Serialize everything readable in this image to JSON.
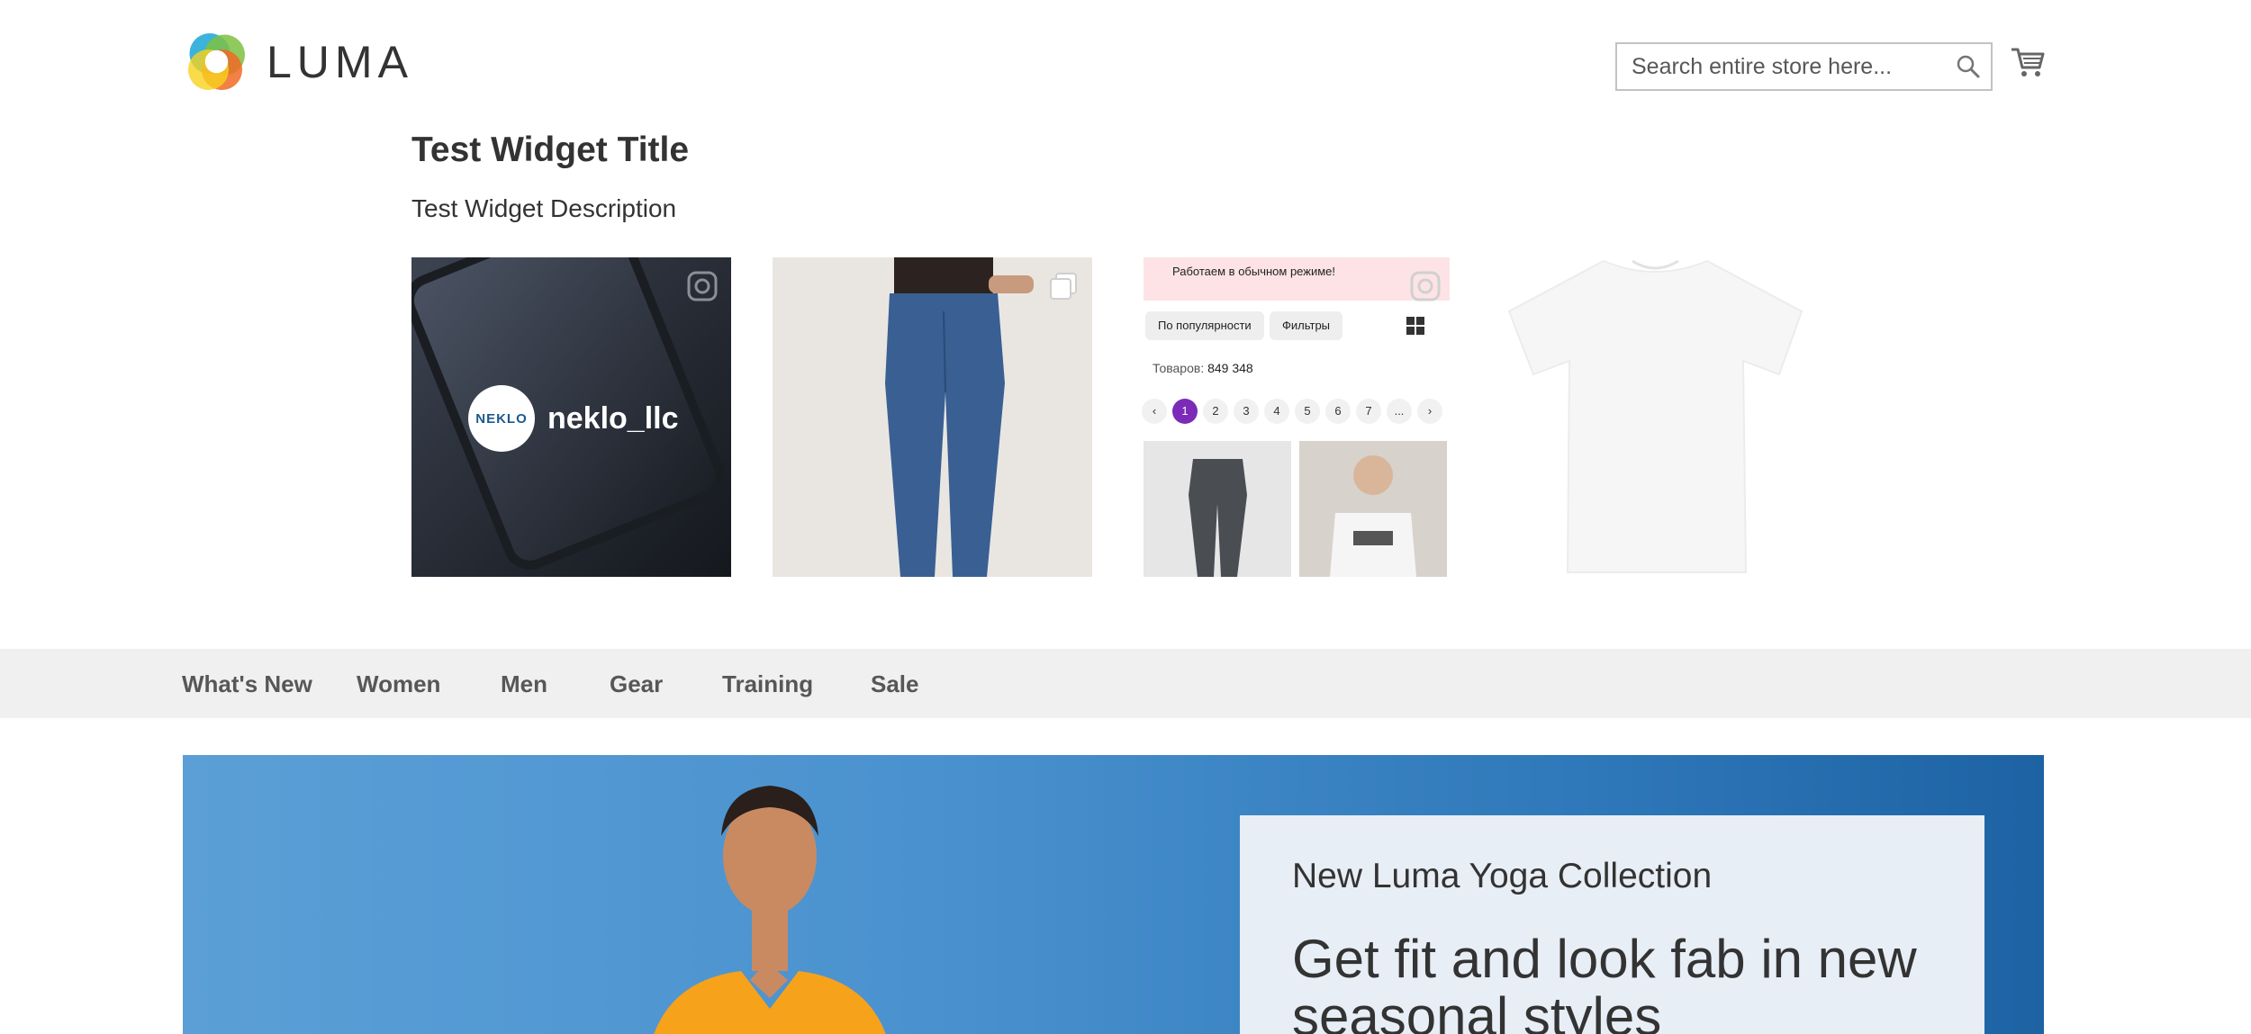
{
  "header": {
    "logo_text": "LUMA",
    "search_placeholder": "Search entire store here...",
    "icons": [
      "search-icon",
      "cart-icon"
    ]
  },
  "widget": {
    "title": "Test Widget Title",
    "description": "Test Widget Description",
    "tile1": {
      "account": "neklo_llc",
      "account_logo": "NEKLO"
    },
    "tile3": {
      "banner": "Работаем в обычном режиме!",
      "chips": [
        "По популярности",
        "Фильтры"
      ],
      "count_label": "Товаров:",
      "count_value": "849 348",
      "pages": [
        "1",
        "2",
        "3",
        "4",
        "5",
        "6",
        "7",
        "..."
      ]
    }
  },
  "nav": {
    "items": [
      "What's New",
      "Women",
      "Men",
      "Gear",
      "Training",
      "Sale"
    ]
  },
  "hero": {
    "subtitle": "New Luma Yoga Collection",
    "headline": "Get fit and look fab in new seasonal styles"
  },
  "colors": {
    "nav_bg": "#f0f0f0",
    "hero_blue": "#2f78b9",
    "accent_purple": "#7b2bb8"
  }
}
